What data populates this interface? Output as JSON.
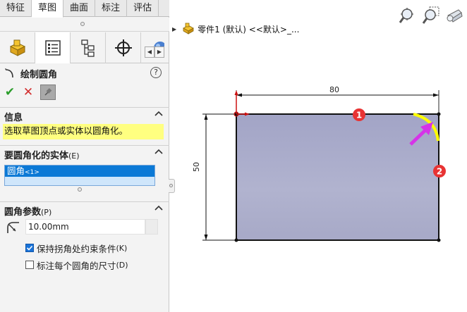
{
  "tabs": [
    {
      "label": "特征",
      "active": false
    },
    {
      "label": "草图",
      "active": true
    },
    {
      "label": "曲面",
      "active": false
    },
    {
      "label": "标注",
      "active": false
    },
    {
      "label": "评估",
      "active": false
    }
  ],
  "manager_tabs": [
    "feature-manager",
    "property-manager",
    "configuration-manager",
    "dimxpert-manager",
    "display-manager"
  ],
  "command": {
    "title": "绘制圆角",
    "help": "?"
  },
  "actions": {
    "ok": "✔",
    "cancel": "✕"
  },
  "info_section": {
    "title": "信息",
    "message": "选取草图顶点或实体以圆角化。"
  },
  "entities_section": {
    "title": "要圆角化的实体",
    "hotkey": "(E)",
    "items": [
      {
        "name": "圆角",
        "tag": "<1>"
      }
    ]
  },
  "params_section": {
    "title": "圆角参数",
    "hotkey": "(P)",
    "radius_value": "10.00mm",
    "keep_constraint_label": "保持拐角处约束条件",
    "keep_constraint_hotkey": "(K)",
    "keep_constraint_checked": true,
    "dim_each_label": "标注每个圆角的尺寸",
    "dim_each_hotkey": "(D)",
    "dim_each_checked": false
  },
  "tree": {
    "part_label": "零件1 (默认) <<默认>_..."
  },
  "sketch": {
    "dim_width": "80",
    "dim_height": "50",
    "marker1": "1",
    "marker2": "2",
    "colors": {
      "rect_fill": "#a6a8c8",
      "arc": "#ffff00",
      "arrow": "#d633e8",
      "marker": "#e83333",
      "origin": "#cc1111"
    }
  }
}
